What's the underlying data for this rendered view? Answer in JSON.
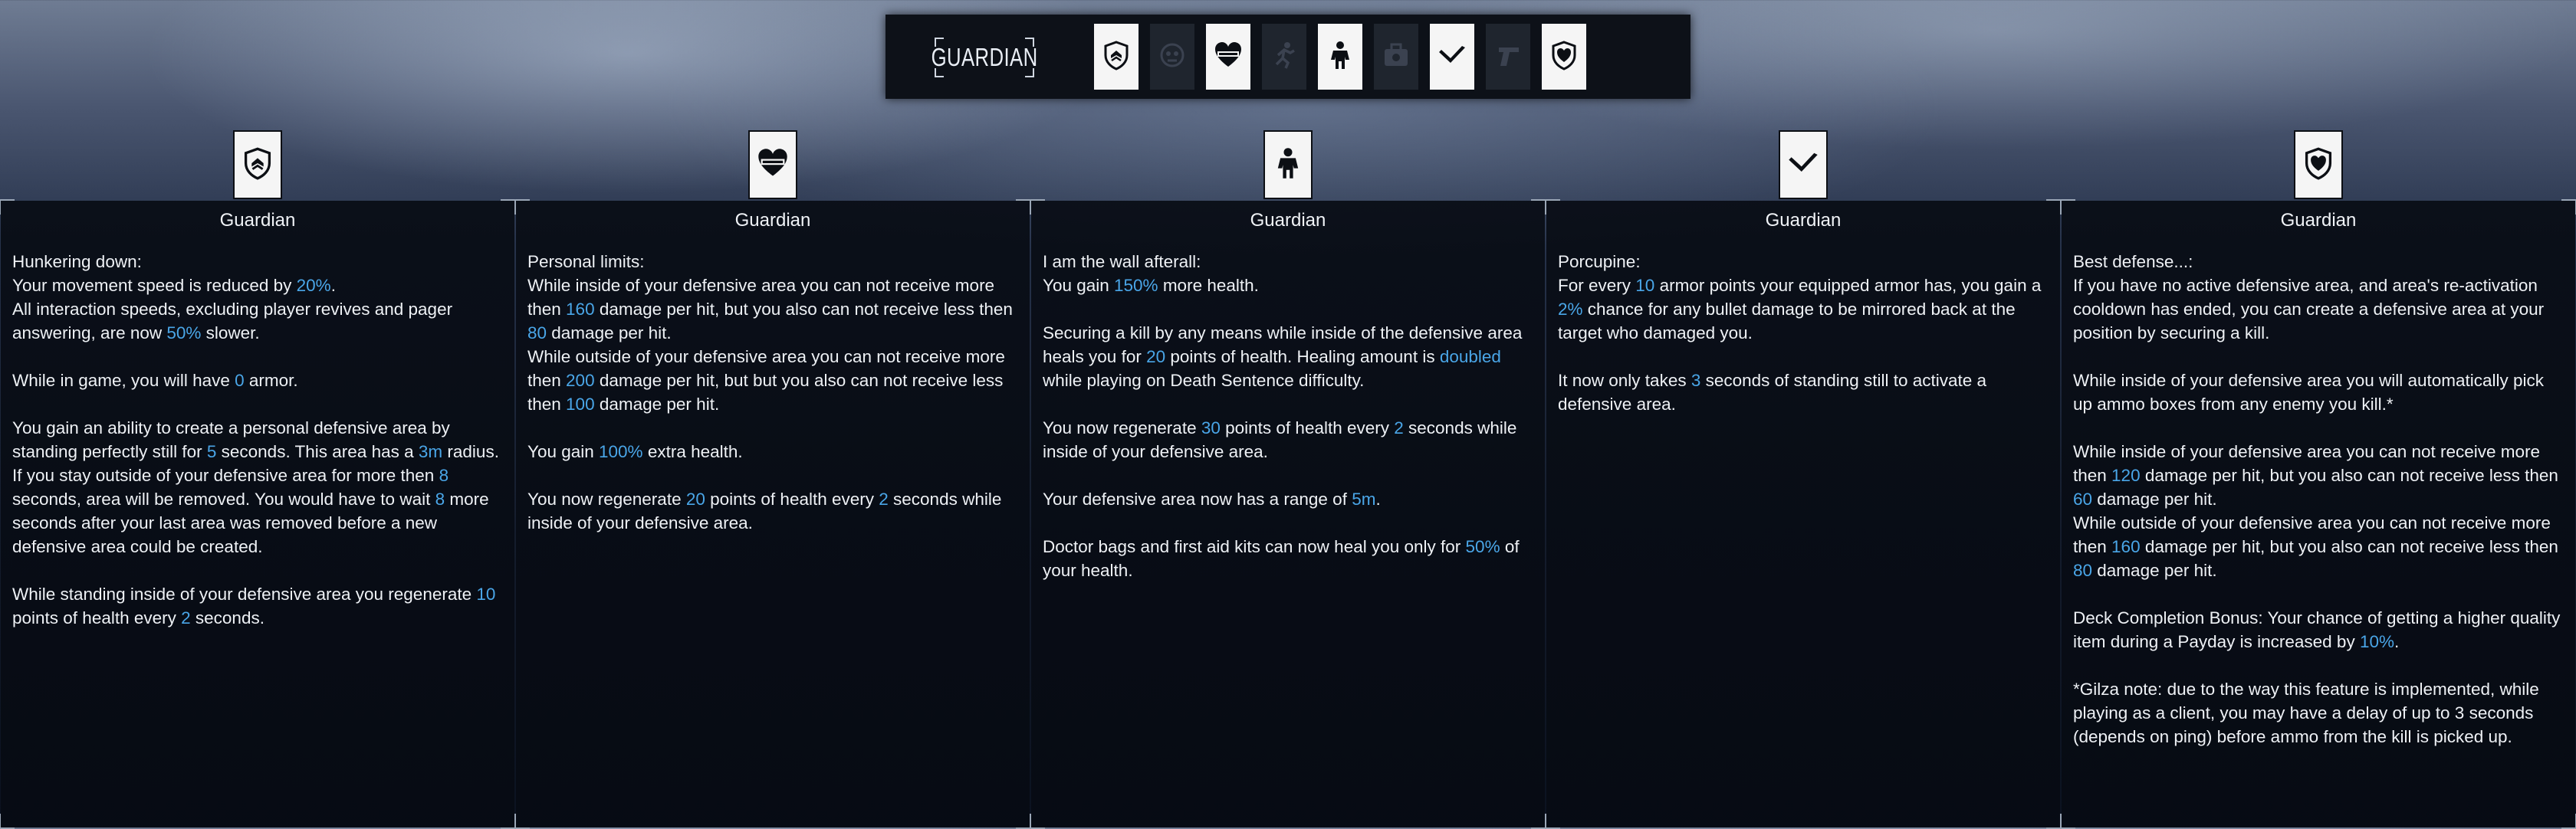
{
  "deck": {
    "title": "GUARDIAN",
    "cards": [
      {
        "icon": "shield-emblem-icon",
        "owned": true
      },
      {
        "icon": "skull-crest-icon",
        "owned": false
      },
      {
        "icon": "heart-band-icon",
        "owned": true
      },
      {
        "icon": "runner-icon",
        "owned": false
      },
      {
        "icon": "armored-soldier-icon",
        "owned": true
      },
      {
        "icon": "bag-icon",
        "owned": false
      },
      {
        "icon": "quill-icon",
        "owned": true
      },
      {
        "icon": "pistol-icon",
        "owned": false
      },
      {
        "icon": "shield-heart-icon",
        "owned": true
      }
    ]
  },
  "columns": [
    {
      "title": "Guardian",
      "icon": "shield-emblem-icon",
      "paragraphs": [
        [
          {
            "t": "Hunkering down:"
          }
        ],
        [
          {
            "t": "Your movement speed is reduced by "
          },
          {
            "t": "20%",
            "h": true
          },
          {
            "t": "."
          }
        ],
        [
          {
            "t": "All interaction speeds, excluding player revives and pager answering, are now "
          },
          {
            "t": "50%",
            "h": true
          },
          {
            "t": " slower."
          }
        ],
        "gap",
        [
          {
            "t": "While in game, you will have "
          },
          {
            "t": "0",
            "h": true
          },
          {
            "t": " armor."
          }
        ],
        "gap",
        [
          {
            "t": "You gain an ability to create a personal defensive area by standing perfectly still for "
          },
          {
            "t": "5",
            "h": true
          },
          {
            "t": " seconds. This area has a "
          },
          {
            "t": "3m",
            "h": true
          },
          {
            "t": " radius. If you stay outside of your defensive area for more then "
          },
          {
            "t": "8",
            "h": true
          },
          {
            "t": " seconds, area will be removed. You would have to wait "
          },
          {
            "t": "8",
            "h": true
          },
          {
            "t": " more seconds after your last area was removed before a new defensive area could be created."
          }
        ],
        "gap",
        [
          {
            "t": "While standing inside of your defensive area you regenerate "
          },
          {
            "t": "10",
            "h": true
          },
          {
            "t": " points of health every "
          },
          {
            "t": "2",
            "h": true
          },
          {
            "t": " seconds."
          }
        ]
      ]
    },
    {
      "title": "Guardian",
      "icon": "heart-band-icon",
      "paragraphs": [
        [
          {
            "t": "Personal limits:"
          }
        ],
        [
          {
            "t": "While inside of your defensive area you can not receive more then "
          },
          {
            "t": "160",
            "h": true
          },
          {
            "t": " damage per hit, but you also can not receive less then "
          },
          {
            "t": "80",
            "h": true
          },
          {
            "t": " damage per hit."
          }
        ],
        [
          {
            "t": "While outside of your defensive area you can not receive more then "
          },
          {
            "t": "200",
            "h": true
          },
          {
            "t": " damage per hit, but but you also can not receive less then "
          },
          {
            "t": "100",
            "h": true
          },
          {
            "t": " damage per hit."
          }
        ],
        "gap",
        [
          {
            "t": "You gain "
          },
          {
            "t": "100%",
            "h": true
          },
          {
            "t": " extra health."
          }
        ],
        "gap",
        [
          {
            "t": "You now regenerate "
          },
          {
            "t": "20",
            "h": true
          },
          {
            "t": " points of health every "
          },
          {
            "t": "2",
            "h": true
          },
          {
            "t": " seconds while inside of your defensive area."
          }
        ]
      ]
    },
    {
      "title": "Guardian",
      "icon": "armored-soldier-icon",
      "paragraphs": [
        [
          {
            "t": "I am the wall afterall:"
          }
        ],
        [
          {
            "t": "You gain "
          },
          {
            "t": "150%",
            "h": true
          },
          {
            "t": " more health."
          }
        ],
        "gap",
        [
          {
            "t": "Securing a kill by any means while inside of the defensive area heals you for "
          },
          {
            "t": "20",
            "h": true
          },
          {
            "t": " points of health. Healing amount is "
          },
          {
            "t": "doubled",
            "h": true
          },
          {
            "t": " while playing on Death Sentence difficulty."
          }
        ],
        "gap",
        [
          {
            "t": "You now regenerate "
          },
          {
            "t": "30",
            "h": true
          },
          {
            "t": " points of health every "
          },
          {
            "t": "2",
            "h": true
          },
          {
            "t": " seconds while inside of your defensive area."
          }
        ],
        "gap",
        [
          {
            "t": "Your defensive area now has a range of "
          },
          {
            "t": "5m",
            "h": true
          },
          {
            "t": "."
          }
        ],
        "gap",
        [
          {
            "t": "Doctor bags and first aid kits can now heal you only for "
          },
          {
            "t": "50%",
            "h": true
          },
          {
            "t": " of your health."
          }
        ]
      ]
    },
    {
      "title": "Guardian",
      "icon": "quill-icon",
      "paragraphs": [
        [
          {
            "t": "Porcupine:"
          }
        ],
        [
          {
            "t": "For every "
          },
          {
            "t": "10",
            "h": true
          },
          {
            "t": " armor points your equipped armor has, you gain a "
          },
          {
            "t": "2%",
            "h": true
          },
          {
            "t": " chance for any bullet damage to be mirrored back at the target who damaged you."
          }
        ],
        "gap",
        [
          {
            "t": "It now only takes "
          },
          {
            "t": "3",
            "h": true
          },
          {
            "t": " seconds of standing still to activate a defensive area."
          }
        ]
      ]
    },
    {
      "title": "Guardian",
      "icon": "shield-heart-icon",
      "paragraphs": [
        [
          {
            "t": "Best defense...:"
          }
        ],
        [
          {
            "t": "If you have no active defensive area, and area's re-activation cooldown has ended, you can create a defensive area at your position by securing a kill."
          }
        ],
        "gap",
        [
          {
            "t": "While inside of your defensive area you will automatically pick up ammo boxes from any enemy you kill.*"
          }
        ],
        "gap",
        [
          {
            "t": "While inside of your defensive area you can not receive more then "
          },
          {
            "t": "120",
            "h": true
          },
          {
            "t": " damage per hit, but you also can not receive less then "
          },
          {
            "t": "60",
            "h": true
          },
          {
            "t": " damage per hit."
          }
        ],
        [
          {
            "t": "While outside of your defensive area you can not receive more then "
          },
          {
            "t": "160",
            "h": true
          },
          {
            "t": " damage per hit, but you also can not receive less then "
          },
          {
            "t": "80",
            "h": true
          },
          {
            "t": " damage per hit."
          }
        ],
        "gap",
        [
          {
            "t": "Deck Completion Bonus: Your chance of getting a higher quality item during a Payday is increased by "
          },
          {
            "t": "10%",
            "h": true
          },
          {
            "t": "."
          }
        ],
        "gap",
        [
          {
            "t": "*Gilza note: due to the way this feature is implemented, while playing as a client, you may have a delay of up to 3 seconds (depends on ping) before ammo from the kill is picked up."
          }
        ]
      ]
    }
  ],
  "colors": {
    "highlight": "#4aa6e8",
    "text": "#eef1f5",
    "card": "#f5f5f5"
  }
}
